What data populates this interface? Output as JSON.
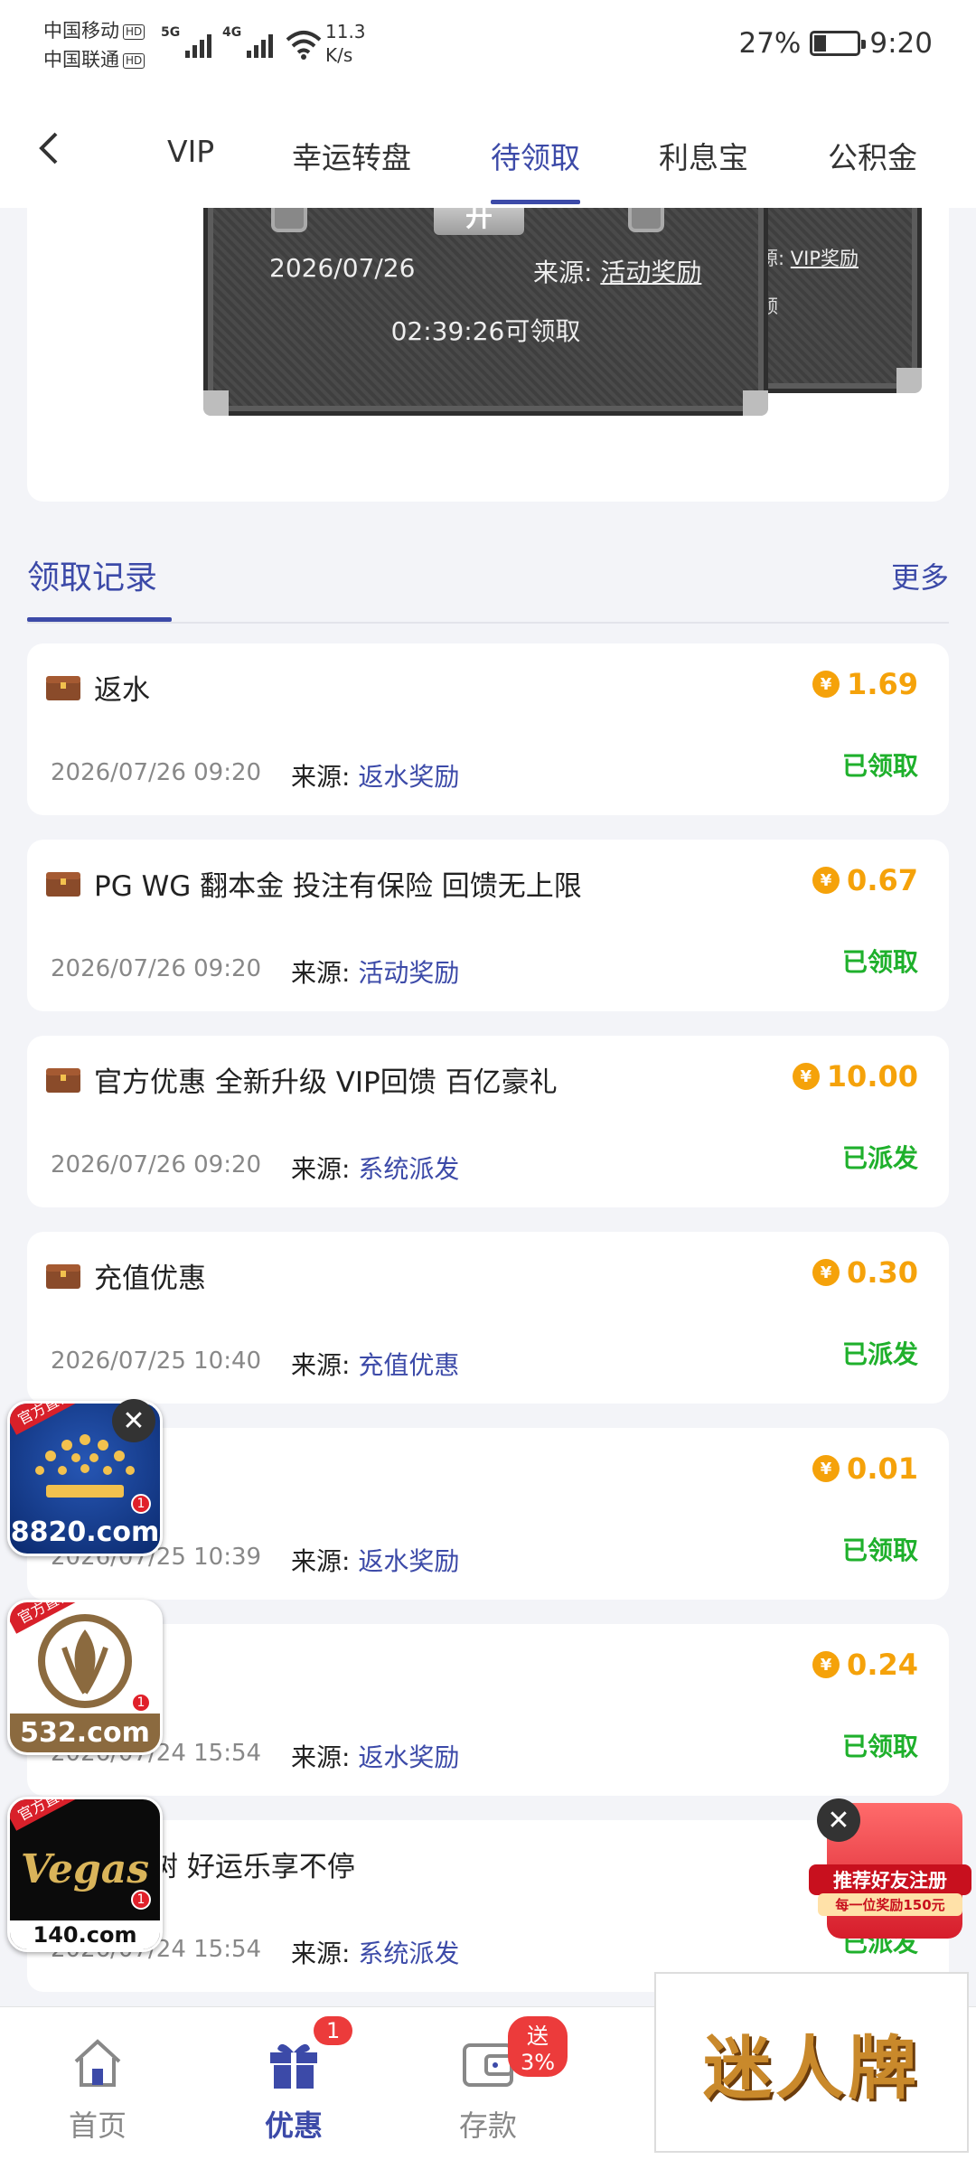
{
  "status_bar": {
    "carrier1": "中国移动",
    "carrier2": "中国联通",
    "hd": "HD",
    "net1": "5G",
    "net2": "4G",
    "speed_value": "11.3",
    "speed_unit": "K/s",
    "battery_text": "27%",
    "battery_level": 0.27,
    "time": "9:20"
  },
  "nav": {
    "back_icon": "chevron-left-icon",
    "tabs": [
      {
        "label": "VIP"
      },
      {
        "label": "幸运转盘"
      },
      {
        "label": "待领取",
        "active": true
      },
      {
        "label": "利息宝"
      },
      {
        "label": "公积金"
      }
    ]
  },
  "chest": {
    "date": "2026/07/26",
    "source_label": "来源:",
    "source_value": "活动奖励",
    "countdown": "02:39:26可领取",
    "lock_glyph": "开",
    "second_source_label": "源:",
    "second_source_value": "VIP奖励",
    "second_claim": "领"
  },
  "records_header": {
    "title": "领取记录",
    "more": "更多"
  },
  "records": [
    {
      "title": "返水",
      "amount": "1.69",
      "status": "已领取",
      "date": "2026/07/26 09:20",
      "source_label": "来源:",
      "source": "返水奖励"
    },
    {
      "title": "PG WG 翻本金 投注有保险 回馈无上限",
      "amount": "0.67",
      "status": "已领取",
      "date": "2026/07/26 09:20",
      "source_label": "来源:",
      "source": "活动奖励"
    },
    {
      "title": "官方优惠 全新升级 VIP回馈 百亿豪礼",
      "amount": "10.00",
      "status": "已派发",
      "date": "2026/07/26 09:20",
      "source_label": "来源:",
      "source": "系统派发"
    },
    {
      "title": "充值优惠",
      "amount": "0.30",
      "status": "已派发",
      "date": "2026/07/25 10:40",
      "source_label": "来源:",
      "source": "充值优惠"
    },
    {
      "title": "",
      "amount": "0.01",
      "status": "已领取",
      "date": "2026/07/25 10:39",
      "source_label": "来源:",
      "source": "返水奖励"
    },
    {
      "title": "",
      "amount": "0.24",
      "status": "已领取",
      "date": "2026/07/24 15:54",
      "source_label": "来源:",
      "source": "返水奖励"
    },
    {
      "title": "摇钱树 好运乐享不停",
      "amount": "",
      "status": "已派发",
      "date": "2026/07/24 15:54",
      "source_label": "来源:",
      "source": "系统派发"
    }
  ],
  "coin_glyph": "¥",
  "floating_ads": [
    {
      "flag": "官方直营",
      "domain": "8820.com",
      "badge": "1"
    },
    {
      "flag": "官方直营",
      "domain": "532.com",
      "badge": "1"
    },
    {
      "flag": "官方直营",
      "domain": "140.com",
      "badge": "1",
      "logo_text": "Vegas"
    }
  ],
  "close_glyph": "✕",
  "invite_ad": {
    "line1": "推荐好友注册",
    "line2": "每一位奖励150元"
  },
  "bottom_nav": [
    {
      "label": "首页",
      "icon": "home-icon"
    },
    {
      "label": "优惠",
      "icon": "gift-icon",
      "active": true,
      "badge": "1"
    },
    {
      "label": "存款",
      "icon": "wallet-icon",
      "badge": "送3%"
    }
  ],
  "brand_ad": {
    "text": "迷人牌"
  }
}
